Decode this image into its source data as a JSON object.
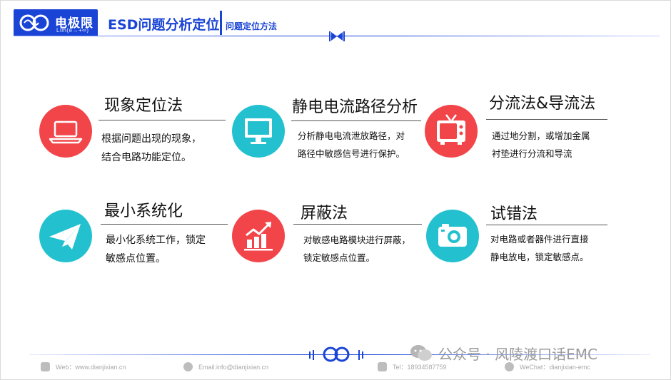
{
  "header": {
    "logo_cn": "电极限",
    "logo_en": "Lim(e→+∞)",
    "title": "ESD问题分析定位",
    "subtitle": "问题定位方法"
  },
  "items": [
    {
      "title": "现象定位法",
      "desc": [
        "根据问题出现的现象，",
        "结合电路功能定位。"
      ],
      "icon": "laptop-icon",
      "color": "#f2454a"
    },
    {
      "title": "静电电流路径分析",
      "desc": [
        "分析静电电流泄放路径，对",
        "路径中敏感信号进行保护。"
      ],
      "icon": "monitor-icon",
      "color": "#23c1cf"
    },
    {
      "title": "分流法&导流法",
      "desc": [
        "通过地分割，或增加金属",
        "衬垫进行分流和导流"
      ],
      "icon": "tv-icon",
      "color": "#f2454a"
    },
    {
      "title": "最小系统化",
      "desc": [
        "最小化系统工作，锁定",
        "敏感点位置。"
      ],
      "icon": "paper-plane-icon",
      "color": "#23c1cf"
    },
    {
      "title": "屏蔽法",
      "desc": [
        "对敏感电路模块进行屏蔽，",
        "锁定敏感点位置。"
      ],
      "icon": "chart-growth-icon",
      "color": "#f2454a"
    },
    {
      "title": "试错法",
      "desc": [
        "对电路或者器件进行直接",
        "静电放电，锁定敏感点。"
      ],
      "icon": "camera-icon",
      "color": "#23c1cf"
    }
  ],
  "footer": {
    "web": "Web：www.dianjixian.cn",
    "email": "Email:info@dianjixian.cn",
    "tel": "Tel：18934587759",
    "wechat": "WeChat：dianjixian-emc"
  },
  "watermark": "公众号 · 风陵渡口话EMC"
}
